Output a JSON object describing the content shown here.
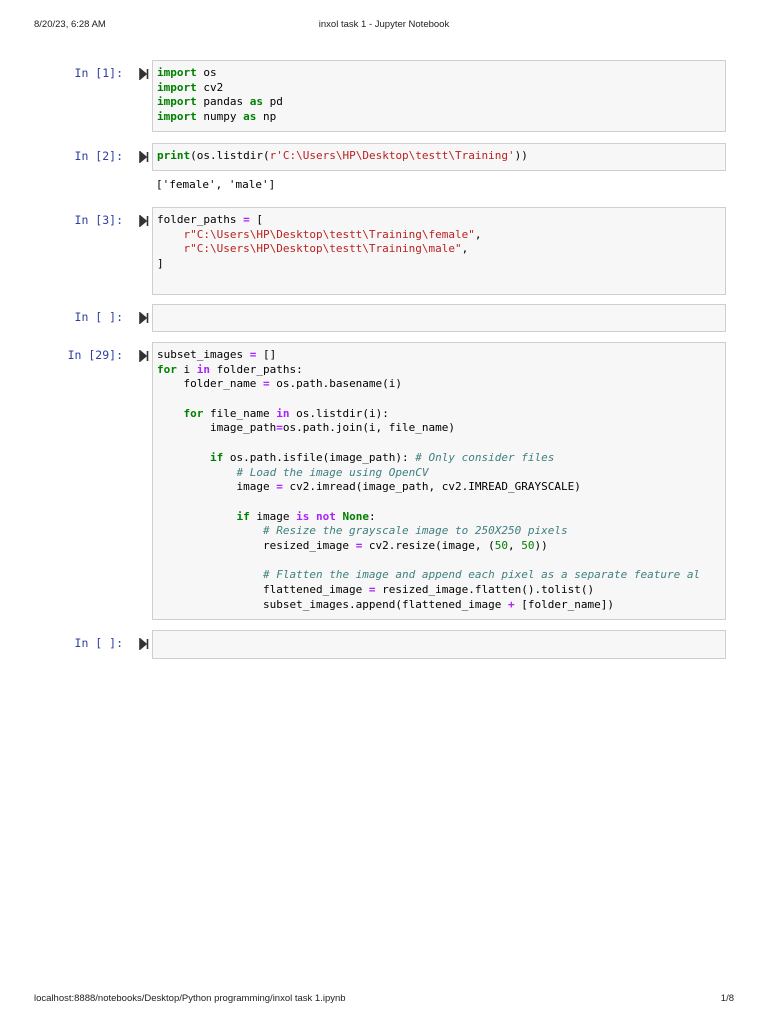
{
  "header": {
    "datetime": "8/20/23, 6:28 AM",
    "title": "inxol task 1 - Jupyter Notebook"
  },
  "footer": {
    "url": "localhost:8888/notebooks/Desktop/Python programming/inxol task 1.ipynb",
    "page": "1/8"
  },
  "cells": [
    {
      "prompt": "In [1]:",
      "lines": [
        [
          [
            "import",
            "k"
          ],
          [
            " os",
            "p"
          ]
        ],
        [
          [
            "import",
            "k"
          ],
          [
            " cv2",
            "p"
          ]
        ],
        [
          [
            "import",
            "k"
          ],
          [
            " pandas ",
            "p"
          ],
          [
            "as",
            "k"
          ],
          [
            " pd",
            "p"
          ]
        ],
        [
          [
            "import",
            "k"
          ],
          [
            " numpy ",
            "p"
          ],
          [
            "as",
            "k"
          ],
          [
            " np",
            "p"
          ]
        ]
      ]
    },
    {
      "prompt": "In [2]:",
      "lines": [
        [
          [
            "print",
            "k"
          ],
          [
            "(os.listdir(",
            "p"
          ],
          [
            "r'C:\\Users\\HP\\Desktop\\testt\\Training'",
            "s"
          ],
          [
            "))",
            "p"
          ]
        ]
      ],
      "output": "['female', 'male']"
    },
    {
      "prompt": "In [3]:",
      "lines": [
        [
          [
            "folder_paths ",
            "p"
          ],
          [
            "=",
            "o"
          ],
          [
            " [",
            "p"
          ]
        ],
        [
          [
            "    ",
            "p"
          ],
          [
            "r\"C:\\Users\\HP\\Desktop\\testt\\Training\\female\"",
            "s"
          ],
          [
            ",",
            "p"
          ]
        ],
        [
          [
            "    ",
            "p"
          ],
          [
            "r\"C:\\Users\\HP\\Desktop\\testt\\Training\\male\"",
            "s"
          ],
          [
            ",",
            "p"
          ]
        ],
        [
          [
            "]",
            "p"
          ]
        ],
        []
      ]
    },
    {
      "prompt": "In [ ]:",
      "lines": [
        []
      ]
    },
    {
      "prompt": "In [29]:",
      "lines": [
        [
          [
            "subset_images ",
            "p"
          ],
          [
            "=",
            "o"
          ],
          [
            " []",
            "p"
          ]
        ],
        [
          [
            "for",
            "k"
          ],
          [
            " i ",
            "p"
          ],
          [
            "in",
            "o"
          ],
          [
            " folder_paths:",
            "p"
          ]
        ],
        [
          [
            "    folder_name ",
            "p"
          ],
          [
            "=",
            "o"
          ],
          [
            " os.path.basename(i)",
            "p"
          ]
        ],
        [],
        [
          [
            "    ",
            "p"
          ],
          [
            "for",
            "k"
          ],
          [
            " file_name ",
            "p"
          ],
          [
            "in",
            "o"
          ],
          [
            " os.listdir(i):",
            "p"
          ]
        ],
        [
          [
            "        image_path",
            "p"
          ],
          [
            "=",
            "o"
          ],
          [
            "os.path.join(i, file_name)",
            "p"
          ]
        ],
        [],
        [
          [
            "        ",
            "p"
          ],
          [
            "if",
            "k"
          ],
          [
            " os.path.isfile(image_path): ",
            "p"
          ],
          [
            "# Only consider files",
            "c"
          ]
        ],
        [
          [
            "            ",
            "p"
          ],
          [
            "# Load the image using OpenCV",
            "c"
          ]
        ],
        [
          [
            "            image ",
            "p"
          ],
          [
            "=",
            "o"
          ],
          [
            " cv2.imread(image_path, cv2.IMREAD_GRAYSCALE)",
            "p"
          ]
        ],
        [],
        [
          [
            "            ",
            "p"
          ],
          [
            "if",
            "k"
          ],
          [
            " image ",
            "p"
          ],
          [
            "is",
            "o"
          ],
          [
            " ",
            "p"
          ],
          [
            "not",
            "o"
          ],
          [
            " ",
            "p"
          ],
          [
            "None",
            "k"
          ],
          [
            ":",
            "p"
          ]
        ],
        [
          [
            "                ",
            "p"
          ],
          [
            "# Resize the grayscale image to 250X250 pixels",
            "c"
          ]
        ],
        [
          [
            "                resized_image ",
            "p"
          ],
          [
            "=",
            "o"
          ],
          [
            " cv2.resize(image, (",
            "p"
          ],
          [
            "50",
            "n"
          ],
          [
            ", ",
            "p"
          ],
          [
            "50",
            "n"
          ],
          [
            "))",
            "p"
          ]
        ],
        [],
        [
          [
            "                ",
            "p"
          ],
          [
            "# Flatten the image and append each pixel as a separate feature al",
            "c"
          ]
        ],
        [
          [
            "                flattened_image ",
            "p"
          ],
          [
            "=",
            "o"
          ],
          [
            " resized_image.flatten().tolist()",
            "p"
          ]
        ],
        [
          [
            "                subset_images.append(flattened_image ",
            "p"
          ],
          [
            "+",
            "o"
          ],
          [
            " [folder_name])",
            "p"
          ]
        ]
      ]
    },
    {
      "prompt": "In [ ]:",
      "lines": [
        []
      ]
    }
  ]
}
